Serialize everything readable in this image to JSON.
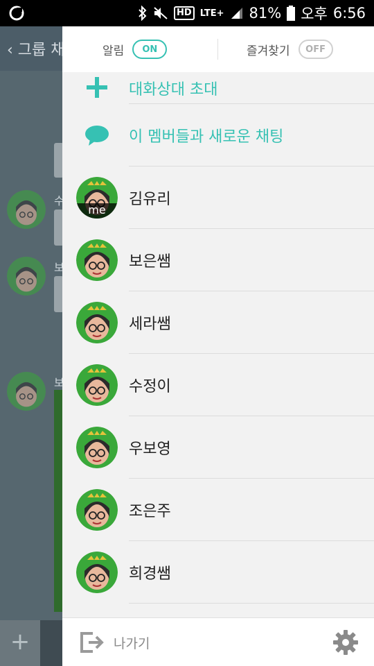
{
  "status_bar": {
    "battery": "81%",
    "ampm": "오후",
    "time": "6:56",
    "network": "LTE+",
    "hd": "HD"
  },
  "background": {
    "title": "그룹 채",
    "names": [
      "수",
      "보",
      "보"
    ]
  },
  "drawer": {
    "notifications": {
      "label": "알림",
      "state": "ON"
    },
    "favorites": {
      "label": "즐겨찾기",
      "state": "OFF"
    },
    "actions": [
      {
        "label": "대화상대 초대",
        "icon": "plus-icon"
      },
      {
        "label": "이 멤버들과 새로운 채팅",
        "icon": "chat-bubble-icon"
      }
    ],
    "members": [
      {
        "name": "김유리",
        "badge": "me"
      },
      {
        "name": "보은쌤"
      },
      {
        "name": "세라쌤"
      },
      {
        "name": "수정이"
      },
      {
        "name": "우보영"
      },
      {
        "name": "조은주"
      },
      {
        "name": "희경쌤"
      }
    ],
    "footer": {
      "leave_label": "나가기",
      "leave_icon": "exit-icon",
      "settings_icon": "gear-icon"
    }
  },
  "colors": {
    "accent": "#36c1b3",
    "drawer_bg": "#f2f2f2",
    "dim_bg": "#5b6d78"
  }
}
